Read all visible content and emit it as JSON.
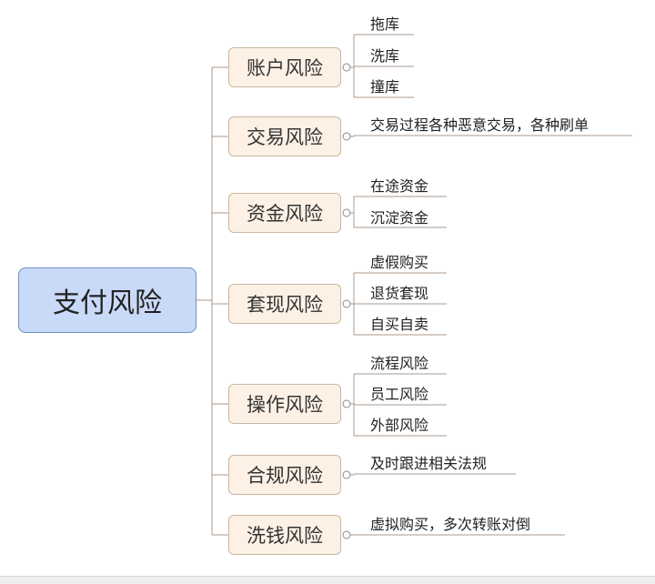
{
  "root": {
    "label": "支付风险"
  },
  "branches": [
    {
      "label": "账户风险",
      "leaves": [
        "拖库",
        "洗库",
        "撞库"
      ]
    },
    {
      "label": "交易风险",
      "leaves": [
        "交易过程各种恶意交易，各种刷单"
      ]
    },
    {
      "label": "资金风险",
      "leaves": [
        "在途资金",
        "沉淀资金"
      ]
    },
    {
      "label": "套现风险",
      "leaves": [
        "虚假购买",
        "退货套现",
        "自买自卖"
      ]
    },
    {
      "label": "操作风险",
      "leaves": [
        "流程风险",
        "员工风险",
        "外部风险"
      ]
    },
    {
      "label": "合规风险",
      "leaves": [
        "及时跟进相关法规"
      ]
    },
    {
      "label": "洗钱风险",
      "leaves": [
        "虚拟购买，多次转账对倒"
      ]
    }
  ],
  "colors": {
    "root_fill": "#c9daf8",
    "branch_fill": "#fdf1e5",
    "connector": "#a89a8c"
  }
}
